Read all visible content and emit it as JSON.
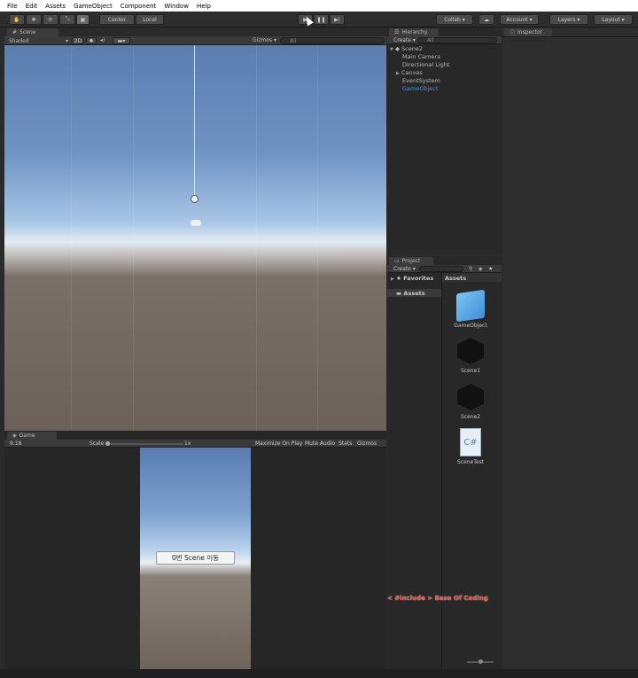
{
  "menu": [
    "File",
    "Edit",
    "Assets",
    "GameObject",
    "Component",
    "Window",
    "Help"
  ],
  "toolbar": {
    "pivot": "Center",
    "space": "Local",
    "collab": "Collab",
    "account": "Account",
    "layers": "Layers",
    "layout": "Layout"
  },
  "scene": {
    "tab": "Scene",
    "shading": "Shaded",
    "mode_2d": "2D",
    "gizmos": "Gizmos",
    "search_placeholder": "All"
  },
  "game": {
    "tab": "Game",
    "aspect": "9:18",
    "scale_label": "Scale",
    "scale_value": "1x",
    "maximize": "Maximize On Play",
    "mute": "Mute Audio",
    "stats": "Stats",
    "gizmos": "Gizmos",
    "button_label": "0번 Scene 이동"
  },
  "hierarchy": {
    "tab": "Hierarchy",
    "create": "Create",
    "search_placeholder": "All",
    "scene": "Scene2",
    "items": [
      "Main Camera",
      "Directional Light",
      "Canvas",
      "EventSystem",
      "GameObject"
    ]
  },
  "project": {
    "tab": "Project",
    "create": "Create",
    "favorites": "Favorites",
    "assets_folder": "Assets",
    "assets_header": "Assets",
    "assets": [
      "GameObject",
      "Scene1",
      "Scene2",
      "SceneTest"
    ]
  },
  "inspector": {
    "tab": "Inspector"
  },
  "watermark": "< #include > Base Of Coding",
  "colors": {
    "accent_selected": "#4d8fe0",
    "watermark": "#e64b3c"
  }
}
